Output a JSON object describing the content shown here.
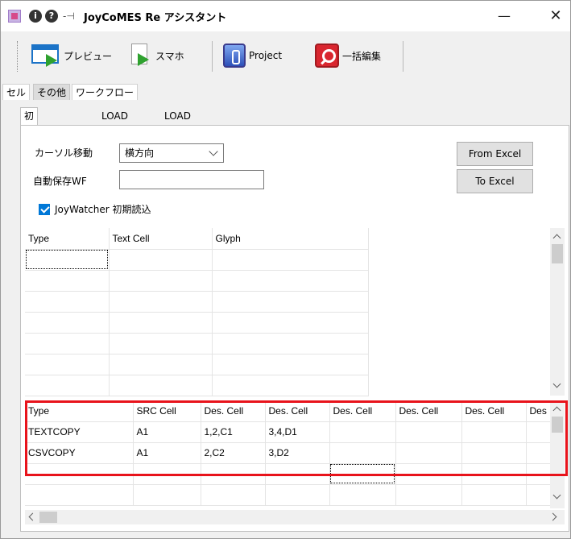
{
  "window": {
    "title": "JoyCoMES Re アシスタント",
    "info_glyph": "i",
    "help_glyph": "?",
    "pin_glyph": "-⊣",
    "minimize_glyph": "—",
    "close_glyph": "✕"
  },
  "toolbar": {
    "preview_label": "プレビュー",
    "smart_label": "スマホ",
    "project_label": "Project",
    "bulk_edit_label": "一括編集"
  },
  "top_tabs": [
    {
      "label": "セル"
    },
    {
      "label": "その他"
    },
    {
      "label": "ワークフロー"
    }
  ],
  "sub_tabs": [
    {
      "label": "初期パラメータ"
    },
    {
      "label": "LOAD CSV"
    },
    {
      "label": "LOAD DB"
    }
  ],
  "form": {
    "cursor_move_label": "カーソル移動",
    "cursor_move_value": "横方向",
    "autosave_label": "自動保存WF",
    "autosave_value": "",
    "from_excel_label": "From Excel",
    "to_excel_label": "To Excel",
    "joywatcher_label": "JoyWatcher 初期読込"
  },
  "grid1": {
    "headers": [
      "Type",
      "Text Cell",
      "Glyph"
    ]
  },
  "grid2": {
    "headers": [
      "Type",
      "SRC Cell",
      "Des. Cell",
      "Des. Cell",
      "Des. Cell",
      "Des. Cell",
      "Des. Cell",
      "Des"
    ],
    "rows": [
      [
        "TEXTCOPY",
        "A1",
        "1,2,C1",
        "3,4,D1",
        "",
        "",
        "",
        ""
      ],
      [
        "CSVCOPY",
        "A1",
        "2,C2",
        "3,D2",
        "",
        "",
        "",
        ""
      ]
    ]
  },
  "colors": {
    "highlight": "#e8131b",
    "checkbox": "#0078d7"
  }
}
